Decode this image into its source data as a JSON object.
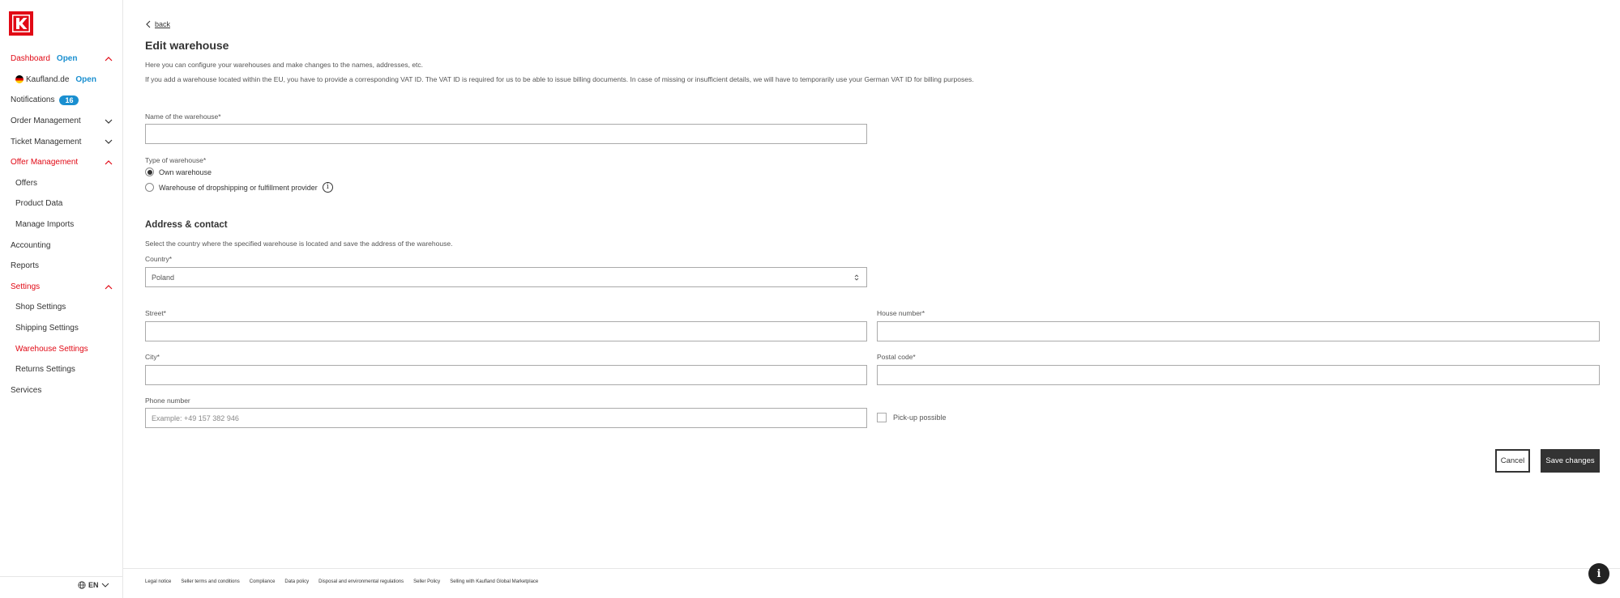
{
  "sidebar": {
    "logo": "K",
    "items": [
      {
        "label": "Dashboard",
        "extra": "Open"
      },
      {
        "label": "Kaufland.de",
        "extra": "Open"
      },
      {
        "label": "Notifications",
        "badge": "16"
      },
      {
        "label": "Order Management"
      },
      {
        "label": "Ticket Management"
      },
      {
        "label": "Offer Management"
      },
      {
        "label": "Offers"
      },
      {
        "label": "Product Data"
      },
      {
        "label": "Manage Imports"
      },
      {
        "label": "Accounting"
      },
      {
        "label": "Reports"
      },
      {
        "label": "Settings"
      },
      {
        "label": "Shop Settings"
      },
      {
        "label": "Shipping Settings"
      },
      {
        "label": "Warehouse Settings"
      },
      {
        "label": "Returns Settings"
      },
      {
        "label": "Services"
      }
    ],
    "language": "EN"
  },
  "page": {
    "back_label": "back",
    "title": "Edit warehouse",
    "description_1": "Here you can configure your warehouses and make changes to the names, addresses, etc.",
    "description_2": "If you add a warehouse located within the EU, you have to provide a corresponding VAT ID. The VAT ID is required for us to be able to issue billing documents. In case of missing or insufficient details, we will have to temporarily use your German VAT ID for billing purposes."
  },
  "form": {
    "name_label": "Name of the warehouse*",
    "name_value": "",
    "type_label": "Type of warehouse*",
    "type_options": [
      "Own warehouse",
      "Warehouse of dropshipping or fulfillment provider"
    ],
    "type_selected": "Own warehouse",
    "address_title": "Address & contact",
    "address_desc": "Select the country where the specified warehouse is located and save the address of the warehouse.",
    "country_label": "Country*",
    "country_value": "Poland",
    "street_label": "Street*",
    "house_label": "House number*",
    "city_label": "City*",
    "postal_label": "Postal code*",
    "phone_label": "Phone number",
    "phone_placeholder": "Example: +49 157 382 946",
    "pickup_label": "Pick-up possible",
    "pickup_checked": false,
    "cancel_label": "Cancel",
    "save_label": "Save changes"
  },
  "footer": {
    "links": [
      "Legal notice",
      "Seller terms and conditions",
      "Compliance",
      "Data policy",
      "Disposal and environmental regulations",
      "Seller Policy",
      "Selling with Kaufland Global Marketplace"
    ]
  },
  "colors": {
    "brand": "#e10915",
    "accent": "#1a8fd0",
    "dark": "#333333"
  }
}
